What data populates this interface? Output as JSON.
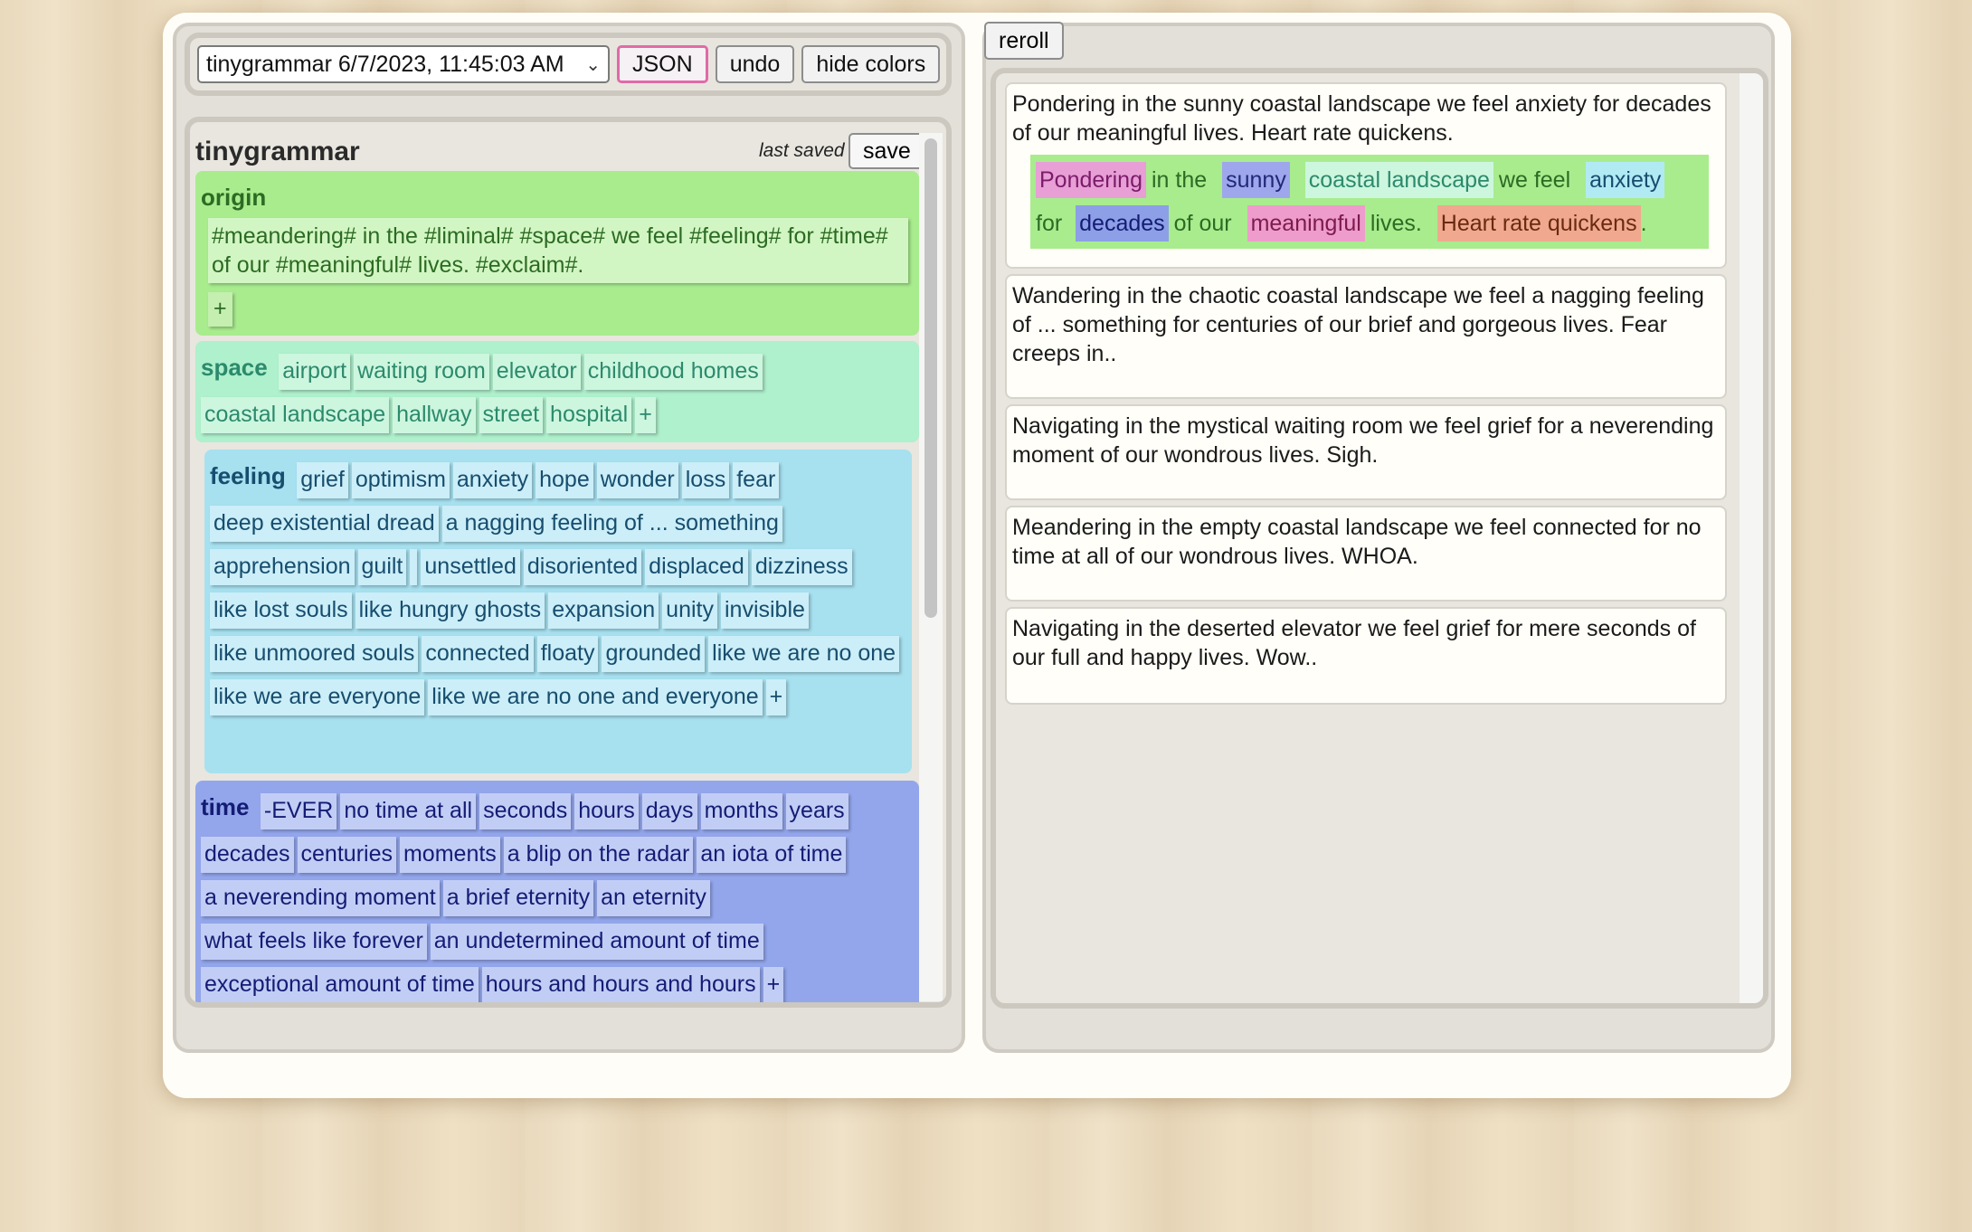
{
  "toolbar": {
    "grammar_select": "tinygrammar 6/7/2023, 11:45:03 AM",
    "json_label": "JSON",
    "undo_label": "undo",
    "hide_colors_label": "hide colors"
  },
  "editor": {
    "title": "tinygrammar",
    "last_saved_label": "last saved",
    "save_label": "save",
    "add_label": "+",
    "rules": {
      "origin": {
        "name": "origin",
        "text": "#meandering# in the #liminal# #space# we feel #feeling# for #time# of our #meaningful# lives. #exclaim#."
      },
      "space": {
        "name": "space",
        "items": [
          "airport",
          "waiting room",
          "elevator",
          "childhood homes",
          "coastal landscape",
          "hallway",
          "street",
          "hospital"
        ]
      },
      "feeling": {
        "name": "feeling",
        "items": [
          "grief",
          "optimism",
          "anxiety",
          "hope",
          "wonder",
          "loss",
          "fear",
          "deep existential dread",
          "a nagging feeling of ... something",
          "apprehension",
          "guilt",
          "",
          "unsettled",
          "disoriented",
          "displaced",
          "dizziness",
          "like lost souls",
          "like hungry ghosts",
          "expansion",
          "unity",
          "invisible",
          "like unmoored souls",
          "connected",
          "floaty",
          "grounded",
          "like we are no one",
          "like we are everyone",
          "like we are no one and everyone"
        ]
      },
      "time": {
        "name": "time",
        "items": [
          "-EVER",
          "no time at all",
          "seconds",
          "hours",
          "days",
          "months",
          "years",
          "decades",
          "centuries",
          "moments",
          "a blip on the radar",
          "an iota of time",
          "a neverending moment",
          "a brief eternity",
          "an eternity",
          "what feels like forever",
          "an undetermined amount of time",
          "exceptional amount of time",
          "hours and hours and hours"
        ]
      }
    }
  },
  "output": {
    "reroll_label": "reroll",
    "results": [
      {
        "text": "Pondering in the sunny coastal landscape we feel anxiety for decades of our meaningful lives. Heart rate quickens.",
        "expansion": {
          "meandering": "Pondering",
          "in_the": "in the",
          "liminal": "sunny",
          "space": "coastal landscape",
          "we_feel": "we feel",
          "feeling": "anxiety",
          "for": "for",
          "time": "decades",
          "of_our": "of our",
          "meaningful": "meaningful",
          "lives": "lives.",
          "exclaim": "Heart rate quickens",
          "period": "."
        }
      },
      {
        "text": "Wandering in the chaotic coastal landscape we feel a nagging feeling of ... something for centuries of our brief and gorgeous lives. Fear creeps in.."
      },
      {
        "text": "Navigating in the mystical waiting room we feel grief for a neverending moment of our wondrous lives. Sigh."
      },
      {
        "text": "Meandering in the empty coastal landscape we feel connected for no time at all of our wondrous lives. WHOA."
      },
      {
        "text": "Navigating in the deserted elevator we feel grief for mere seconds of our full and happy lives. Wow.."
      }
    ]
  }
}
